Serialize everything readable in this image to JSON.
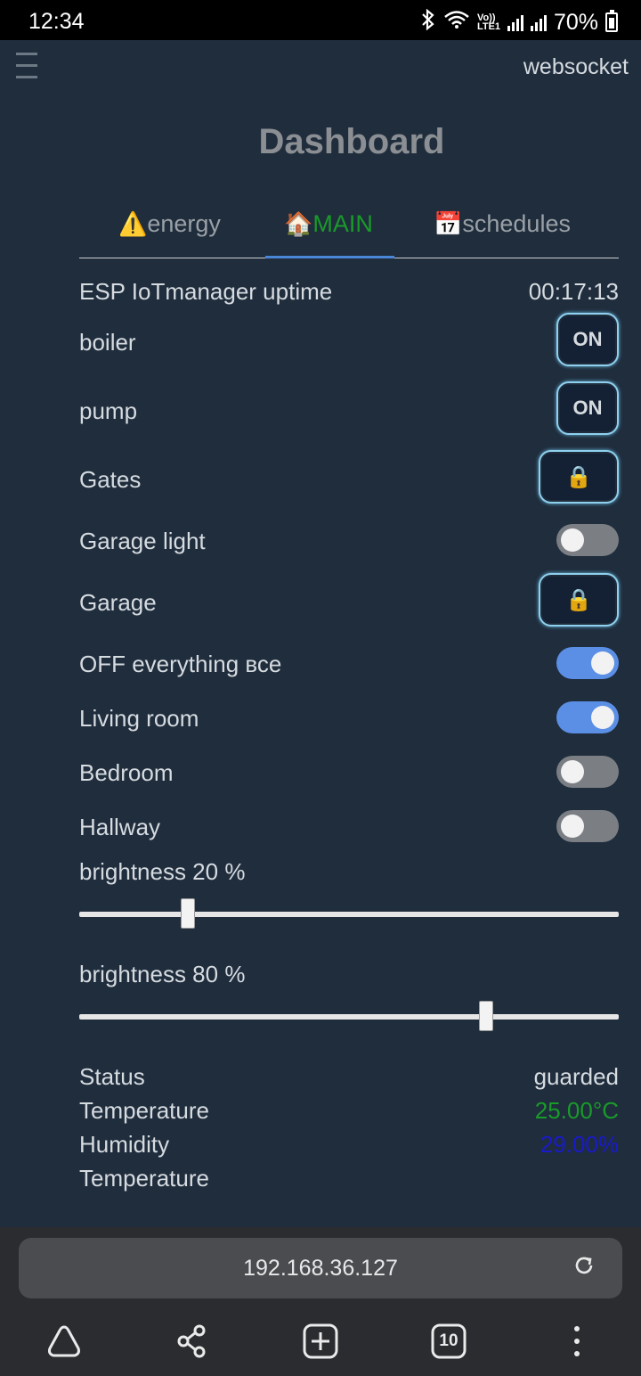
{
  "status_bar": {
    "time": "12:34",
    "network_label": "Vo)) LTE1",
    "battery": "70%"
  },
  "header": {
    "menu_icon": "hamburger-icon",
    "connection": "websocket",
    "title": "Dashboard"
  },
  "tabs": [
    {
      "icon": "⚠️",
      "label": "energy",
      "active": false
    },
    {
      "icon": "🏠",
      "label": "MAIN",
      "active": true
    },
    {
      "icon": "📅",
      "label": "schedules",
      "active": false
    }
  ],
  "uptime": {
    "label": "ESP IoTmanager uptime",
    "value": "00:17:13"
  },
  "buttons": [
    {
      "label": "boiler",
      "button_text": "ON"
    },
    {
      "label": "pump",
      "button_text": "ON"
    },
    {
      "label": "Gates",
      "button_icon": "🔒"
    },
    {
      "label": "Garage",
      "button_icon": "🔒"
    }
  ],
  "toggles": [
    {
      "label": "Garage light",
      "checked": false
    },
    {
      "label": "OFF everything все",
      "checked": true
    },
    {
      "label": "Living room",
      "checked": true
    },
    {
      "label": "Bedroom",
      "checked": false
    },
    {
      "label": "Hallway",
      "checked": false
    }
  ],
  "sliders": [
    {
      "label": "brightness 20 %",
      "value": 20
    },
    {
      "label": "brightness 80 %",
      "value": 80
    }
  ],
  "readouts": [
    {
      "label": "Status",
      "value": "guarded",
      "color": "#d6dbe0"
    },
    {
      "label": "Temperature",
      "value": "25.00°C",
      "color": "#1a9a2a"
    },
    {
      "label": "Humidity",
      "value": "29.00%",
      "color": "#1a1acc"
    },
    {
      "label": "Temperature",
      "value": "",
      "color": "#d6dbe0"
    }
  ],
  "browser": {
    "url": "192.168.36.127",
    "reload_icon": "reload-icon",
    "tab_count": "10",
    "nav_icons": [
      "home-icon",
      "share-icon",
      "new-tab-icon",
      "tabs-icon",
      "more-icon"
    ]
  }
}
